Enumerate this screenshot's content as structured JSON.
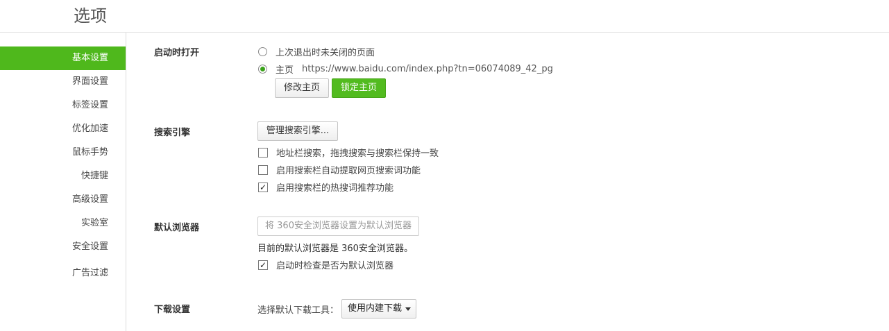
{
  "title": "选项",
  "sidebar": {
    "items": [
      {
        "label": "基本设置"
      },
      {
        "label": "界面设置"
      },
      {
        "label": "标签设置"
      },
      {
        "label": "优化加速"
      },
      {
        "label": "鼠标手势"
      },
      {
        "label": "快捷键"
      },
      {
        "label": "高级设置"
      },
      {
        "label": "实验室"
      },
      {
        "label": "安全设置"
      },
      {
        "label": "广告过滤"
      }
    ],
    "active": "基本设置"
  },
  "startup": {
    "label": "启动时打开",
    "option_last": "上次退出时未关闭的页面",
    "option_home": "主页",
    "home_url": "https://www.baidu.com/index.php?tn=06074089_42_pg",
    "selected": "主页",
    "edit_home_button": "修改主页",
    "lock_home_button": "锁定主页"
  },
  "search": {
    "label": "搜索引擎",
    "manage_button": "管理搜索引擎...",
    "options": [
      {
        "label": "地址栏搜索，拖拽搜索与搜索栏保持一致",
        "checked": false
      },
      {
        "label": "启用搜索栏自动提取网页搜索词功能",
        "checked": false
      },
      {
        "label": "启用搜索栏的热搜词推荐功能",
        "checked": true
      }
    ]
  },
  "default_browser": {
    "label": "默认浏览器",
    "set_default_button": "将 360安全浏览器设置为默认浏览器",
    "status_text": "目前的默认浏览器是 360安全浏览器。",
    "check_on_start": {
      "label": "启动时检查是否为默认浏览器",
      "checked": true
    }
  },
  "download": {
    "label": "下载设置",
    "tool_label": "选择默认下载工具：",
    "tool_selected": "使用内建下载"
  },
  "colors": {
    "accent": "#4fb81c"
  }
}
